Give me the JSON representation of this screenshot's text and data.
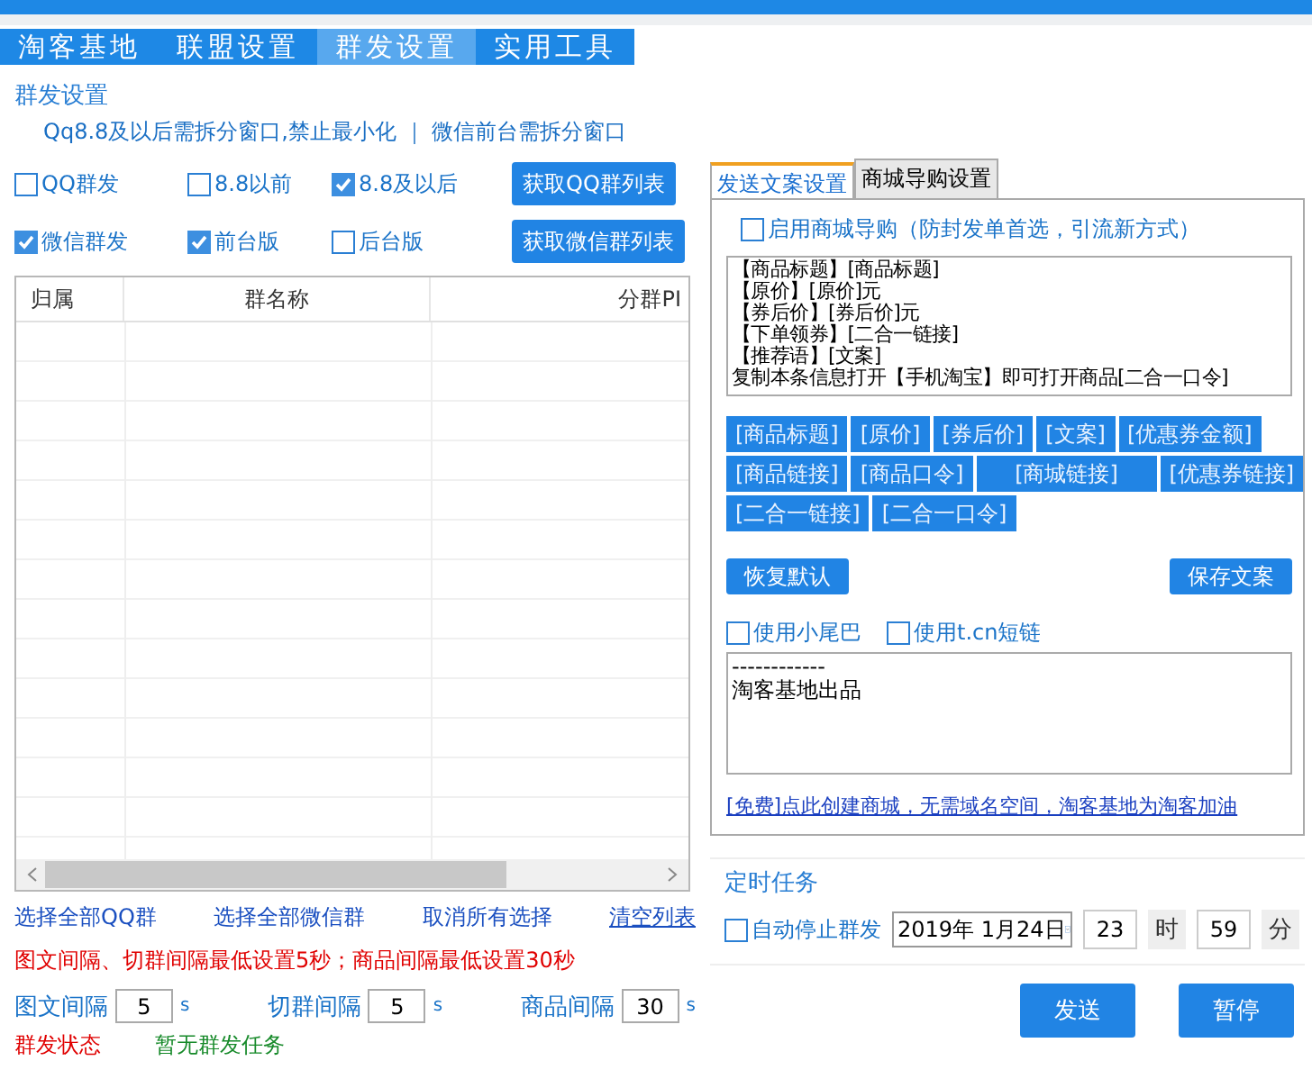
{
  "nav_tabs": [
    {
      "label": "淘客基地",
      "selected": false
    },
    {
      "label": "联盟设置",
      "selected": false
    },
    {
      "label": "群发设置",
      "selected": true
    },
    {
      "label": "实用工具",
      "selected": false
    }
  ],
  "left": {
    "title": "群发设置",
    "notice": "Qq8.8及以后需拆分窗口,禁止最小化 ｜ 微信前台需拆分窗口",
    "option_rows": [
      {
        "checkboxes": [
          {
            "label": "QQ群发",
            "checked": false
          },
          {
            "label": "8.8以前",
            "checked": false
          },
          {
            "label": "8.8及以后",
            "checked": true
          }
        ],
        "button": "获取QQ群列表"
      },
      {
        "checkboxes": [
          {
            "label": "微信群发",
            "checked": true
          },
          {
            "label": "前台版",
            "checked": true
          },
          {
            "label": "后台版",
            "checked": false
          }
        ],
        "button": "获取微信群列表"
      }
    ],
    "table": {
      "columns": [
        "归属",
        "群名称",
        "分群PI"
      ]
    },
    "links": [
      {
        "label": "选择全部QQ群",
        "kind": "plain"
      },
      {
        "label": "选择全部微信群",
        "kind": "plain"
      },
      {
        "label": "取消所有选择",
        "kind": "plain"
      },
      {
        "label": "清空列表",
        "kind": "underlined"
      }
    ],
    "warning": "图文间隔、切群间隔最低设置5秒；商品间隔最低设置30秒",
    "intervals": [
      {
        "label": "图文间隔",
        "value": "5",
        "unit": "s"
      },
      {
        "label": "切群间隔",
        "value": "5",
        "unit": "s"
      },
      {
        "label": "商品间隔",
        "value": "30",
        "unit": "s"
      }
    ],
    "status": {
      "label": "群发状态",
      "value": "暂无群发任务"
    }
  },
  "right": {
    "tabs": [
      {
        "label": "发送文案设置",
        "selected": true
      },
      {
        "label": "商城导购设置",
        "selected": false
      }
    ],
    "mall_guide": {
      "label": "启用商城导购（防封发单首选，引流新方式）",
      "checked": false
    },
    "template": [
      "【商品标题】[商品标题]",
      "【原价】[原价]元",
      "【券后价】[券后价]元",
      "【下单领券】[二合一链接]",
      "【推荐语】[文案]",
      "复制本条信息打开【手机淘宝】即可打开商品[二合一口令]"
    ],
    "tag_rows": [
      [
        "[商品标题]",
        "[原价]",
        "[券后价]",
        "[文案]",
        "[优惠券金额]"
      ],
      [
        "[商品链接]",
        "[商品口令]",
        "[商城链接]",
        "[优惠券链接]"
      ],
      [
        "[二合一链接]",
        "[二合一口令]"
      ]
    ],
    "restore_button": "恢复默认",
    "save_button": "保存文案",
    "tail_options": [
      {
        "label": "使用小尾巴",
        "checked": false
      },
      {
        "label": "使用t.cn短链",
        "checked": false
      }
    ],
    "tail_text": [
      "------------",
      "淘客基地出品"
    ],
    "promo_link": "[免费]点此创建商城，无需域名空间，淘客基地为淘客加油",
    "schedule": {
      "title": "定时任务",
      "auto_stop": {
        "label": "自动停止群发",
        "checked": false
      },
      "date": "2019年  1月24日",
      "hour": "23",
      "hour_unit": "时",
      "minute": "59",
      "minute_unit": "分"
    },
    "send_button": "发送",
    "pause_button": "暂停"
  }
}
